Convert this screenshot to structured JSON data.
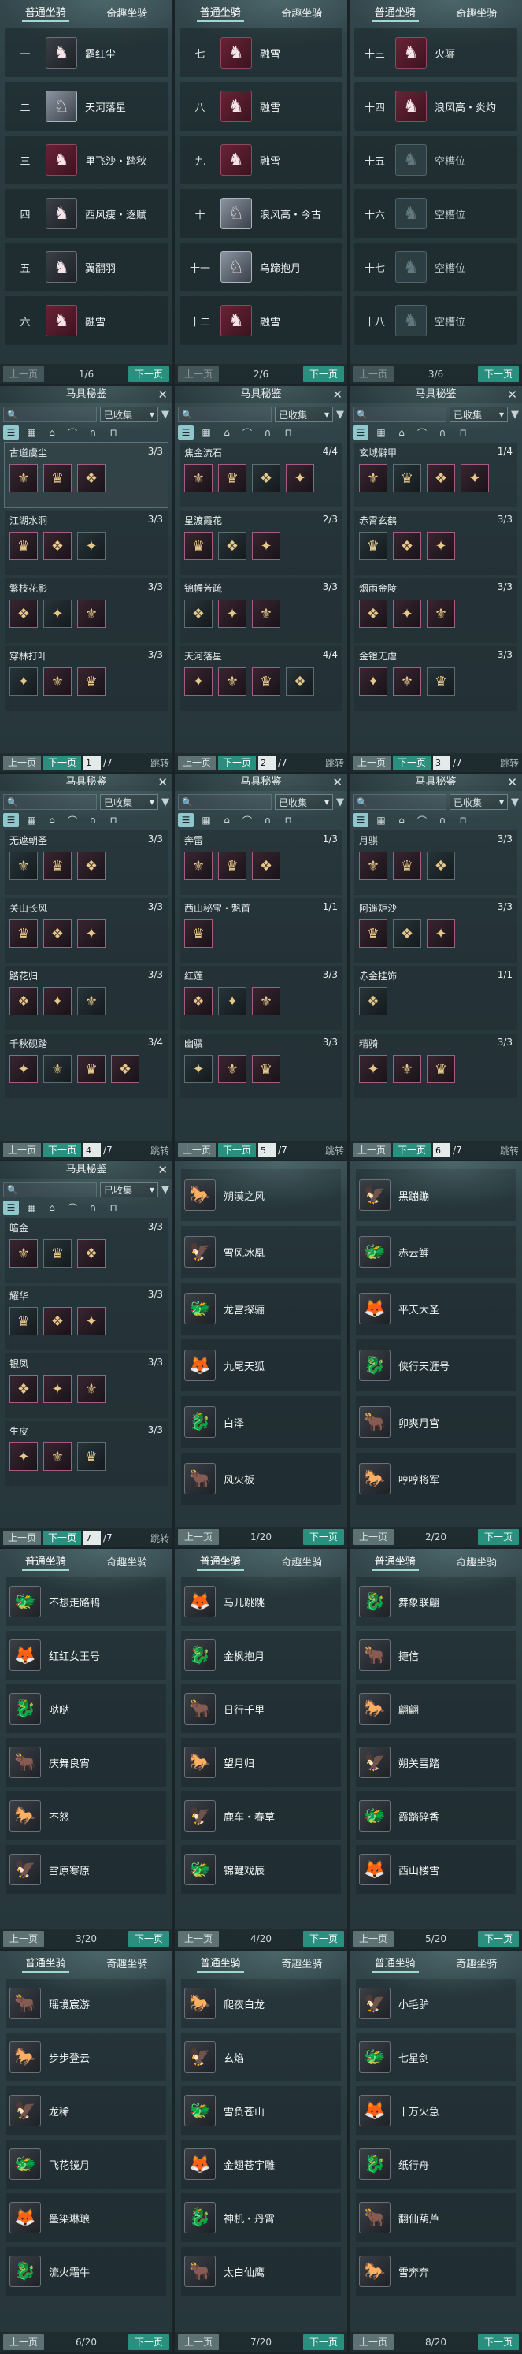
{
  "tabs": {
    "normal": "普通坐骑",
    "special": "奇趣坐骑"
  },
  "buttons": {
    "prev": "上一页",
    "next": "下一页",
    "jump": "跳转"
  },
  "codex": {
    "title": "马具秘鉴",
    "filter": "已收集",
    "filter_icon": "filter-icon",
    "close": "✕"
  },
  "slot_pages": [
    {
      "page": "1/6",
      "rows": [
        {
          "n": "一",
          "name": "霸红尘",
          "ic": "dk"
        },
        {
          "n": "二",
          "name": "天河落星",
          "ic": "wt"
        },
        {
          "n": "三",
          "name": "里飞沙・踏秋",
          "ic": ""
        },
        {
          "n": "四",
          "name": "西风瘦・逐赋",
          "ic": "dk"
        },
        {
          "n": "五",
          "name": "翼翻羽",
          "ic": "dk"
        },
        {
          "n": "六",
          "name": "融雪",
          "ic": ""
        }
      ]
    },
    {
      "page": "2/6",
      "rows": [
        {
          "n": "七",
          "name": "融雪",
          "ic": ""
        },
        {
          "n": "八",
          "name": "融雪",
          "ic": ""
        },
        {
          "n": "九",
          "name": "融雪",
          "ic": ""
        },
        {
          "n": "十",
          "name": "浪风高・今古",
          "ic": "wt"
        },
        {
          "n": "十一",
          "name": "乌蹄抱月",
          "ic": "wt"
        },
        {
          "n": "十二",
          "name": "融雪",
          "ic": ""
        }
      ]
    },
    {
      "page": "3/6",
      "rows": [
        {
          "n": "十三",
          "name": "火骊",
          "ic": ""
        },
        {
          "n": "十四",
          "name": "浪风高・炎灼",
          "ic": ""
        },
        {
          "n": "十五",
          "name": "空槽位",
          "ic": "em"
        },
        {
          "n": "十六",
          "name": "空槽位",
          "ic": "em"
        },
        {
          "n": "十七",
          "name": "空槽位",
          "ic": "em"
        },
        {
          "n": "十八",
          "name": "空槽位",
          "ic": "em"
        }
      ]
    }
  ],
  "codex_pages": [
    {
      "page": "1",
      "total": "/7",
      "groups": [
        {
          "name": "古道虞尘",
          "count": "3/3",
          "n": 3,
          "sel": true
        },
        {
          "name": "江湖水洞",
          "count": "3/3",
          "n": 3
        },
        {
          "name": "繁枝花影",
          "count": "3/3",
          "n": 3
        },
        {
          "name": "穿林打叶",
          "count": "3/3",
          "n": 3
        }
      ]
    },
    {
      "page": "2",
      "total": "/7",
      "groups": [
        {
          "name": "焦金流石",
          "count": "4/4",
          "n": 4
        },
        {
          "name": "星渡霞花",
          "count": "2/3",
          "n": 3
        },
        {
          "name": "锦幄芳疏",
          "count": "3/3",
          "n": 3
        },
        {
          "name": "天河落星",
          "count": "4/4",
          "n": 4
        }
      ]
    },
    {
      "page": "3",
      "total": "/7",
      "groups": [
        {
          "name": "玄域僻甲",
          "count": "1/4",
          "n": 4
        },
        {
          "name": "赤霄玄鹤",
          "count": "3/3",
          "n": 3
        },
        {
          "name": "烟雨金陵",
          "count": "3/3",
          "n": 3
        },
        {
          "name": "金镫无虐",
          "count": "3/3",
          "n": 3
        }
      ]
    },
    {
      "page": "4",
      "total": "/7",
      "groups": [
        {
          "name": "无遮朝圣",
          "count": "3/3",
          "n": 3
        },
        {
          "name": "关山长风",
          "count": "3/3",
          "n": 3
        },
        {
          "name": "踏花归",
          "count": "3/3",
          "n": 3
        },
        {
          "name": "千秋砚踏",
          "count": "3/4",
          "n": 4
        }
      ]
    },
    {
      "page": "5",
      "total": "/7",
      "groups": [
        {
          "name": "奔雷",
          "count": "1/3",
          "n": 3
        },
        {
          "name": "西山秘宝・魁首",
          "count": "1/1",
          "n": 1
        },
        {
          "name": "红莲",
          "count": "3/3",
          "n": 3
        },
        {
          "name": "幽骥",
          "count": "3/3",
          "n": 3
        }
      ]
    },
    {
      "page": "6",
      "total": "/7",
      "groups": [
        {
          "name": "月骐",
          "count": "3/3",
          "n": 3
        },
        {
          "name": "阿遥矩沙",
          "count": "3/3",
          "n": 3
        },
        {
          "name": "赤金挂饰",
          "count": "1/1",
          "n": 1
        },
        {
          "name": "精骑",
          "count": "3/3",
          "n": 3
        }
      ]
    },
    {
      "page": "7",
      "total": "/7",
      "groups": [
        {
          "name": "暗金",
          "count": "3/3",
          "n": 3
        },
        {
          "name": "耀华",
          "count": "3/3",
          "n": 3
        },
        {
          "name": "银凤",
          "count": "3/3",
          "n": 3
        },
        {
          "name": "生皮",
          "count": "3/3",
          "n": 3
        }
      ]
    }
  ],
  "special_pages": [
    {
      "page": "1/20",
      "items": [
        "朔漠之风",
        "雪风冰凰",
        "龙宫探骊",
        "九尾天狐",
        "白泽",
        "风火板"
      ]
    },
    {
      "page": "2/20",
      "items": [
        "黑蹦蹦",
        "赤云鲤",
        "平天大圣",
        "侠行天涯号",
        "卯爽月宫",
        "哼哼将军"
      ]
    },
    {
      "page": "3/20",
      "items": [
        "不想走路鸭",
        "红红女王号",
        "哒哒",
        "庆舞良宵",
        "不怒",
        "雪原寒原"
      ]
    },
    {
      "page": "4/20",
      "items": [
        "马儿跳跳",
        "金枫抱月",
        "日行千里",
        "望月归",
        "鹿车・春草",
        "锦鲤戏辰"
      ]
    },
    {
      "page": "5/20",
      "items": [
        "舞象联翩",
        "捷信",
        "翩翩",
        "朔关雪踏",
        "霞踏碎香",
        "西山楼雪"
      ]
    },
    {
      "page": "6/20",
      "items": [
        "瑶境宸游",
        "步步登云",
        "龙稀",
        "飞花镜月",
        "墨染琳琅",
        "流火霜牛"
      ]
    },
    {
      "page": "7/20",
      "items": [
        "爬夜白龙",
        "玄焰",
        "雪负苍山",
        "金翅苍宇雕",
        "神机・丹霄",
        "太白仙鹰"
      ]
    },
    {
      "page": "8/20",
      "items": [
        "小毛驴",
        "七星剑",
        "十万火急",
        "纸行舟",
        "翻仙葫芦",
        "雪奔奔"
      ]
    }
  ]
}
